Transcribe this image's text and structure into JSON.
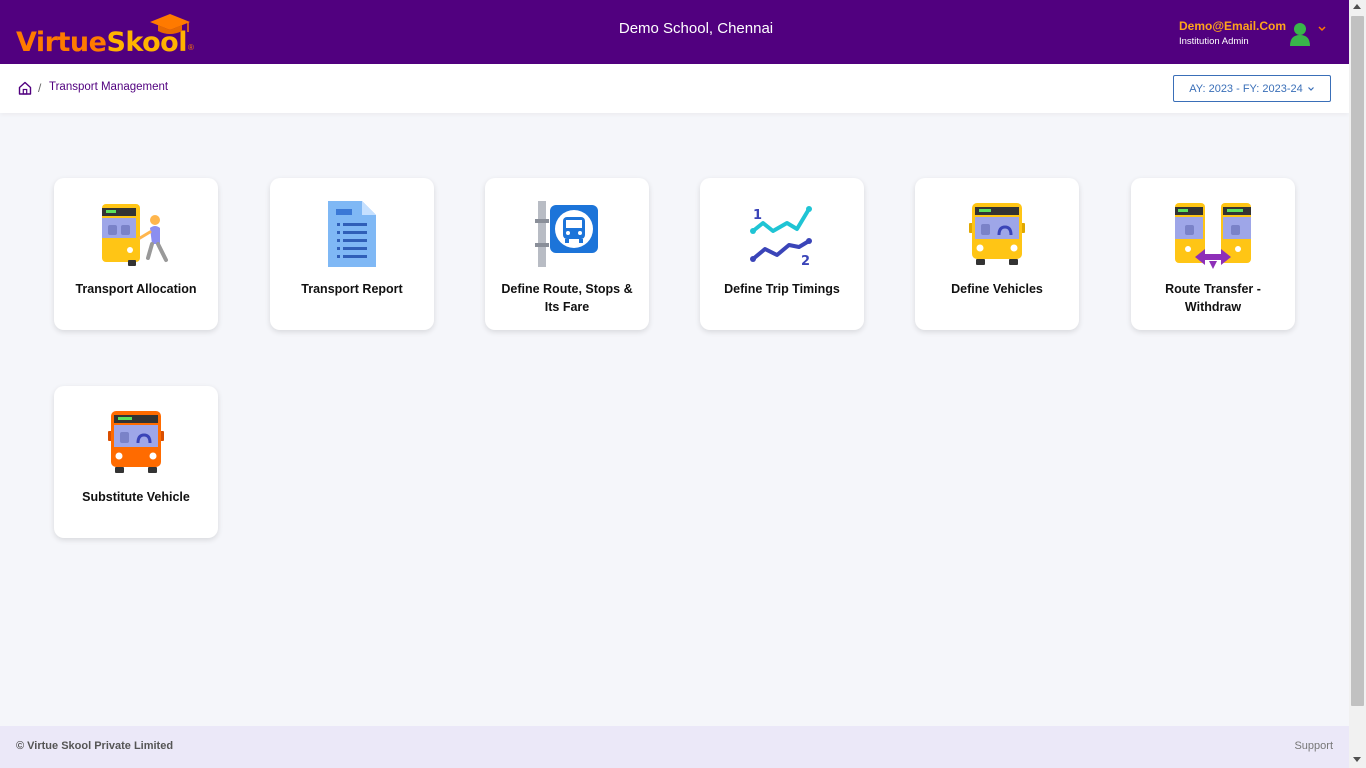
{
  "header": {
    "logo": {
      "part1": "Virtue",
      "part2": "Skool",
      "reg": "®"
    },
    "school_name": "Demo School, Chennai",
    "user_email": "Demo@Email.Com",
    "user_role": "Institution Admin"
  },
  "breadcrumb": {
    "separator": "/",
    "current": "Transport Management"
  },
  "year_select": {
    "value": "AY: 2023 - FY: 2023-24"
  },
  "cards": [
    {
      "label": "Transport Allocation",
      "icon": "bus-boarding-icon"
    },
    {
      "label": "Transport Report",
      "icon": "bus-report-icon"
    },
    {
      "label": "Define Route, Stops & Its Fare",
      "icon": "bus-stop-icon"
    },
    {
      "label": "Define Trip Timings",
      "icon": "trip-timings-chart-icon"
    },
    {
      "label": "Define Vehicles",
      "icon": "bus-icon"
    },
    {
      "label": "Route Transfer - Withdraw",
      "icon": "route-transfer-icon"
    },
    {
      "label": "Substitute Vehicle",
      "icon": "substitute-bus-icon"
    }
  ],
  "footer": {
    "copyright": "© Virtue Skool Private Limited",
    "support": "Support"
  },
  "colors": {
    "header_bg": "#51007f",
    "accent_orange": "#ff7a00",
    "email_orange": "#ffa41b",
    "select_blue": "#3a6fb8",
    "footer_bg": "#ebe8f8"
  }
}
